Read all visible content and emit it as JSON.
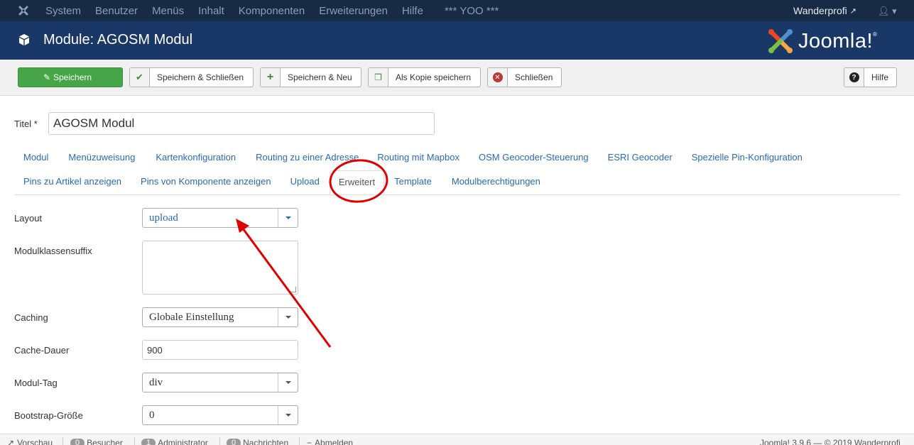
{
  "topnav": {
    "menu": [
      "System",
      "Benutzer",
      "Menüs",
      "Inhalt",
      "Komponenten",
      "Erweiterungen",
      "Hilfe"
    ],
    "site": "*** YOO ***",
    "user": "Wanderprofi"
  },
  "header": {
    "title": "Module: AGOSM Modul",
    "brand": "Joomla!"
  },
  "toolbar": {
    "save": "Speichern",
    "save_close": "Speichern & Schließen",
    "save_new": "Speichern & Neu",
    "save_copy": "Als Kopie speichern",
    "close": "Schließen",
    "help": "Hilfe"
  },
  "form": {
    "title_label": "Titel *",
    "title_value": "AGOSM Modul"
  },
  "tabs_row1": [
    "Modul",
    "Menüzuweisung",
    "Kartenkonfiguration",
    "Routing zu einer Adresse",
    "Routing mit Mapbox",
    "OSM Geocoder-Steuerung",
    "ESRI Geocoder",
    "Spezielle Pin-Konfiguration"
  ],
  "tabs_row2": [
    "Pins zu Artikel anzeigen",
    "Pins von Komponente anzeigen",
    "Upload",
    "Erweitert",
    "Template",
    "Modulberechtigungen"
  ],
  "fields": {
    "layout_label": "Layout",
    "layout_value": "upload",
    "suffix_label": "Modulklassensuffix",
    "caching_label": "Caching",
    "caching_value": "Globale Einstellung",
    "cache_time_label": "Cache-Dauer",
    "cache_time_value": "900",
    "module_tag_label": "Modul-Tag",
    "module_tag_value": "div",
    "bootstrap_label": "Bootstrap-Größe",
    "bootstrap_value": "0"
  },
  "status": {
    "preview": "Vorschau",
    "visitors_count": "0",
    "visitors": "Besucher",
    "admins_count": "1",
    "admins": "Administrator",
    "messages_count": "0",
    "messages": "Nachrichten",
    "logout": "Abmelden",
    "version": "Joomla! 3.9.6 — © 2019 Wanderprofi"
  },
  "colors": {
    "topnav": "#172b44",
    "header": "#1a3867",
    "save_button": "#46a546",
    "link": "#2a69b8",
    "annotation": "#e00000"
  }
}
